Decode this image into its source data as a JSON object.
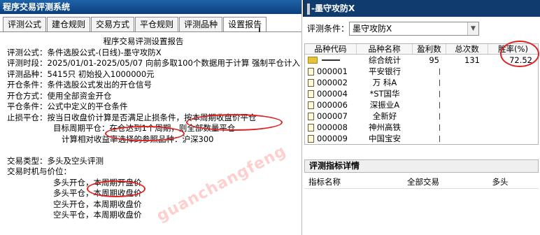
{
  "left_window": {
    "title": "程序交易评测系统",
    "tabs": [
      {
        "label": "评测公式"
      },
      {
        "label": "建仓规则"
      },
      {
        "label": "交易方式"
      },
      {
        "label": "平仓规则"
      },
      {
        "label": "评测品种"
      },
      {
        "label": "设置报告"
      }
    ],
    "report": {
      "heading": "程序交易评测设置报告",
      "lines": [
        "评测公式：条件选股公式-(日线)-墨守攻防X",
        "评测时段：2025/01/01-2025/05/07  向前多取100个数据用于计算  强制平仓计入收",
        "评测品种：5415只  初始投入1000000元",
        "开仓条件：条件选股公式发出的开仓信号",
        "开仓方式：使用全部资金开仓",
        "平仓条件：公式中定义的平仓条件",
        "止损平仓：按当日收盘价计算是否满足止损条件，按本周期收盘价平仓"
      ],
      "target_line": "目标周期平仓：在仓达到1个周期，则全部数量平仓",
      "benchmark_line": "计算相对收益率选择的参照品种：沪深300",
      "trade_type": "交易类型：多头及空头评测",
      "timing_label": "交易时机与价位：",
      "timing_lines": [
        "多头开仓，本周期开盘价",
        "多头平仓，本周期收盘价",
        "空头开仓，本周期收盘价",
        "空头平仓，本周期收盘价"
      ]
    },
    "watermark": "guanchangfeng"
  },
  "right_window": {
    "title": "-墨守攻防X",
    "criteria_label": "评测条件：",
    "criteria_value": "墨守攻防X",
    "table": {
      "headers": [
        "品种代码",
        "品种名称",
        "盈利数",
        "总次数",
        "胜率(%)"
      ],
      "summary": {
        "name": "综合统计",
        "wins": "95",
        "total": "131",
        "rate": "72.52"
      },
      "rows": [
        {
          "code": "000001",
          "name": "平安银行"
        },
        {
          "code": "000002",
          "name": "万 科A"
        },
        {
          "code": "000004",
          "name": "*ST国华"
        },
        {
          "code": "000006",
          "name": "深振业A"
        },
        {
          "code": "000007",
          "name": "全新好"
        },
        {
          "code": "000008",
          "name": "神州高铁"
        },
        {
          "code": "000009",
          "name": "中国宝安"
        }
      ]
    },
    "detail": {
      "title": "评测指标详情",
      "headers": [
        "指标名称",
        "全部交易",
        "多头"
      ]
    }
  },
  "colors": {
    "title_bar": "#0f3b6f",
    "highlight_ring": "#e02020",
    "folder": "#e8c23a"
  }
}
